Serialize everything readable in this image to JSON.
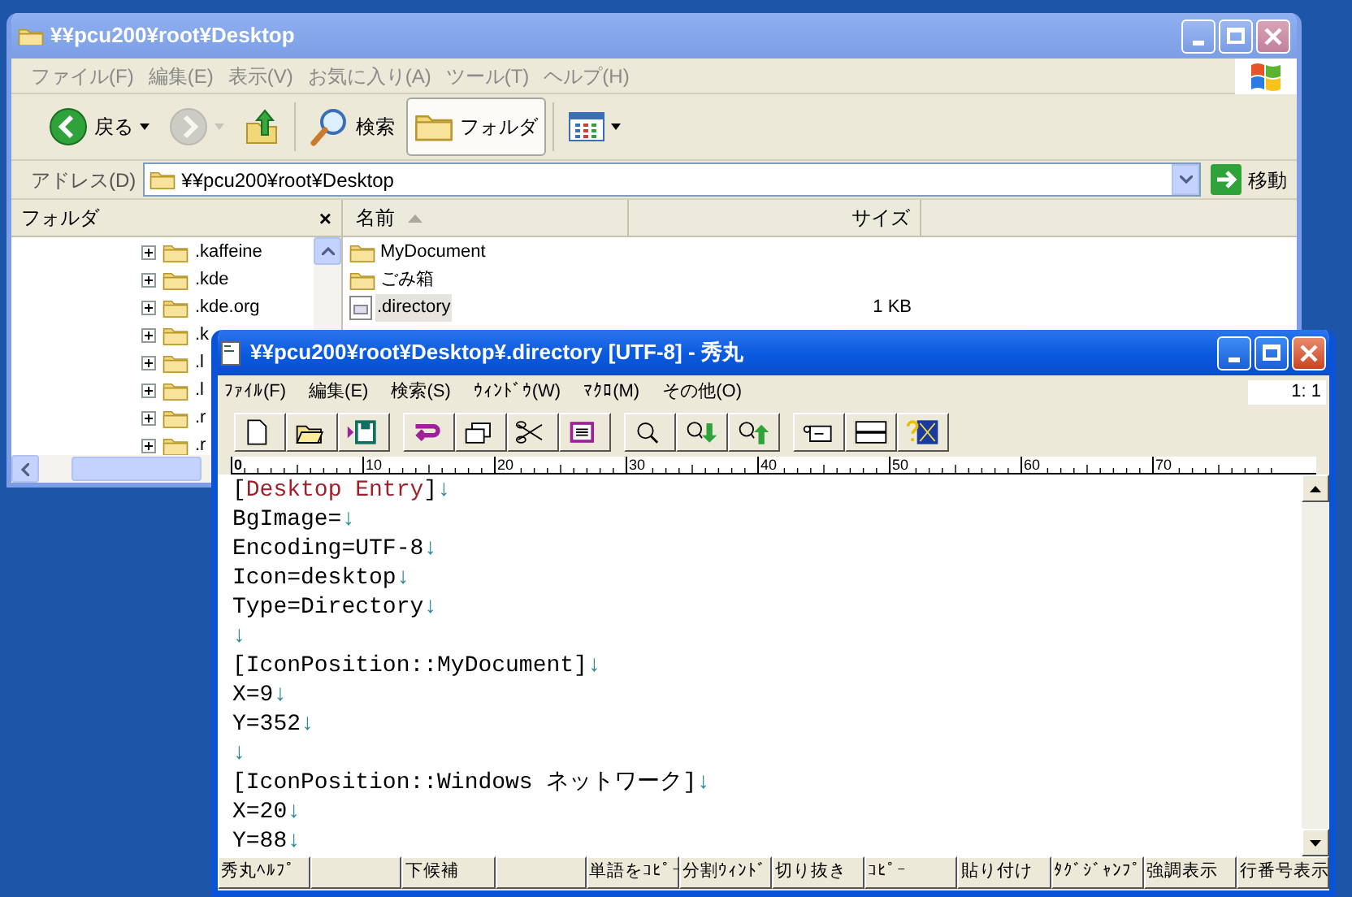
{
  "explorer": {
    "active": false,
    "title": "¥¥pcu200¥root¥Desktop",
    "menu": [
      "ファイル(F)",
      "編集(E)",
      "表示(V)",
      "お気に入り(A)",
      "ツール(T)",
      "ヘルプ(H)"
    ],
    "toolbar": [
      {
        "kind": "back",
        "label": "戻る",
        "disabled": false,
        "pressed": false
      },
      {
        "kind": "forward",
        "disabled": true,
        "pressed": false
      },
      {
        "kind": "up",
        "disabled": false,
        "pressed": false
      },
      {
        "kind": "search",
        "label": "検索",
        "disabled": false,
        "pressed": false
      },
      {
        "kind": "folders",
        "label": "フォルダ",
        "disabled": false,
        "pressed": true
      },
      {
        "kind": "views",
        "disabled": false,
        "pressed": false
      }
    ],
    "address": {
      "label": "アドレス(D)",
      "value": "¥¥pcu200¥root¥Desktop",
      "go": "移動"
    },
    "folder_pane": {
      "title": "フォルダ",
      "close": "×",
      "items": [
        {
          "label": ".kaffeine",
          "expanded": false
        },
        {
          "label": ".kde",
          "expanded": false
        },
        {
          "label": ".kde.org",
          "expanded": false
        },
        {
          "label": ".k",
          "expanded": false
        },
        {
          "label": ".l",
          "expanded": false
        },
        {
          "label": ".l",
          "expanded": false
        },
        {
          "label": ".r",
          "expanded": false
        },
        {
          "label": ".r",
          "expanded": false
        }
      ]
    },
    "file_list": {
      "columns": [
        "名前",
        "サイズ"
      ],
      "rows": [
        {
          "kind": "folder",
          "name": "MyDocument",
          "selected": false
        },
        {
          "kind": "folder",
          "name": "ごみ箱",
          "selected": false
        },
        {
          "kind": "file",
          "name": ".directory",
          "size": "1 KB",
          "selected": true
        }
      ]
    }
  },
  "editor": {
    "active": true,
    "title": "¥¥pcu200¥root¥Desktop¥.directory [UTF-8] - 秀丸",
    "menu": [
      "ﾌｧｲﾙ(F)",
      "編集(E)",
      "検索(S)",
      "ｳｨﾝﾄﾞｳ(W)",
      "ﾏｸﾛ(M)",
      "その他(O)"
    ],
    "cursor": "1: 1",
    "toolbar": [
      {
        "kind": "new"
      },
      {
        "kind": "open"
      },
      {
        "kind": "save"
      },
      {
        "kind": "undo"
      },
      {
        "kind": "copy"
      },
      {
        "kind": "cut"
      },
      {
        "kind": "select"
      },
      {
        "kind": "find"
      },
      {
        "kind": "find-next"
      },
      {
        "kind": "find-prev"
      },
      {
        "kind": "tag"
      },
      {
        "kind": "split"
      },
      {
        "kind": "help"
      }
    ],
    "ruler": [
      "0",
      "10",
      "20",
      "30",
      "40",
      "50",
      "60",
      "70"
    ],
    "lines": [
      {
        "segments": [
          {
            "kind": "plain",
            "text": "["
          },
          {
            "kind": "keyword",
            "text": "Desktop Entry"
          },
          {
            "kind": "plain",
            "text": "]"
          }
        ],
        "eol": "↓"
      },
      {
        "segments": [
          {
            "kind": "plain",
            "text": "BgImage="
          }
        ],
        "eol": "↓"
      },
      {
        "segments": [
          {
            "kind": "plain",
            "text": "Encoding=UTF-8"
          }
        ],
        "eol": "↓"
      },
      {
        "segments": [
          {
            "kind": "plain",
            "text": "Icon=desktop"
          }
        ],
        "eol": "↓"
      },
      {
        "segments": [
          {
            "kind": "plain",
            "text": "Type=Directory"
          }
        ],
        "eol": "↓"
      },
      {
        "eol": "↓"
      },
      {
        "segments": [
          {
            "kind": "plain",
            "text": "[IconPosition::MyDocument]"
          }
        ],
        "eol": "↓"
      },
      {
        "segments": [
          {
            "kind": "plain",
            "text": "X=9"
          }
        ],
        "eol": "↓"
      },
      {
        "segments": [
          {
            "kind": "plain",
            "text": "Y=352"
          }
        ],
        "eol": "↓"
      },
      {
        "eol": "↓"
      },
      {
        "segments": [
          {
            "kind": "plain",
            "text": "[IconPosition::Windows ネットワーク]"
          }
        ],
        "eol": "↓"
      },
      {
        "segments": [
          {
            "kind": "plain",
            "text": "X=20"
          }
        ],
        "eol": "↓"
      },
      {
        "segments": [
          {
            "kind": "plain",
            "text": "Y=88"
          }
        ],
        "eol": "↓"
      }
    ],
    "function_keys": [
      {
        "kind": "key",
        "label": "秀丸ﾍﾙﾌﾟ"
      },
      {
        "kind": "empty"
      },
      {
        "kind": "key",
        "label": "下候補"
      },
      {
        "kind": "empty"
      },
      {
        "kind": "key",
        "label": "単語をｺﾋﾟｰ"
      },
      {
        "kind": "key",
        "label": "分割ｳｨﾝﾄﾞ"
      },
      {
        "kind": "key",
        "label": "切り抜き"
      },
      {
        "kind": "key",
        "label": "ｺﾋﾟｰ"
      },
      {
        "kind": "key",
        "label": "貼り付け"
      },
      {
        "kind": "key",
        "label": "ﾀｸﾞｼﾞｬﾝﾌﾟ"
      },
      {
        "kind": "key",
        "label": "強調表示"
      },
      {
        "kind": "key",
        "label": "行番号表示"
      }
    ]
  }
}
